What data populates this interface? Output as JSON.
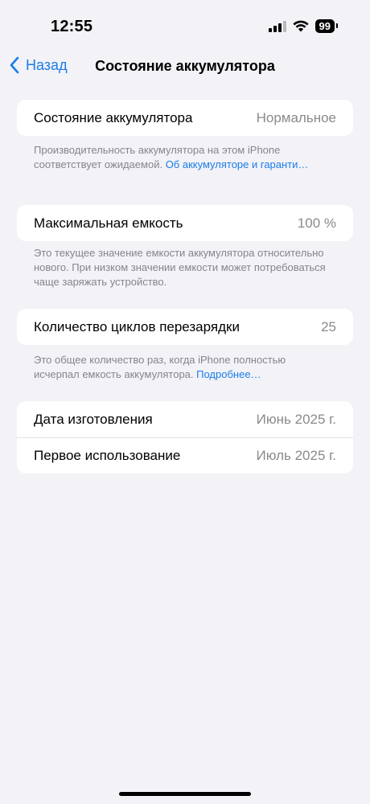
{
  "status_bar": {
    "time": "12:55",
    "battery_level": "99",
    "signal_bars": 3,
    "icons": [
      "cellular-signal-icon",
      "wifi-icon",
      "battery-icon"
    ]
  },
  "nav": {
    "back_label": "Назад",
    "title": "Состояние аккумулятора",
    "accent_color": "#1a7de8"
  },
  "battery_health": {
    "label": "Состояние аккумулятора",
    "value": "Нормальное",
    "note_text": "Производительность аккумулятора на этом iPhone соответствует ожидаемой. ",
    "note_link": "Об аккумуляторе и гаран­ти…"
  },
  "max_capacity": {
    "label": "Максимальная емкость",
    "value": "100 %",
    "note_text": "Это текущее значение емкости аккумулятора относительно нового. При низком значении емкости может потребоваться чаще заряжать устройство."
  },
  "cycle_count": {
    "label": "Количество циклов перезарядки",
    "value": "25",
    "note_text": "Это общее количество раз, когда iPhone полностью исчерпал емкость аккумулятора. ",
    "note_link": "Подробнее…"
  },
  "dates": {
    "manufacture_label": "Дата изготовления",
    "manufacture_value": "Июнь 2025 г.",
    "first_use_label": "Первое использование",
    "first_use_value": "Июль 2025 г."
  }
}
